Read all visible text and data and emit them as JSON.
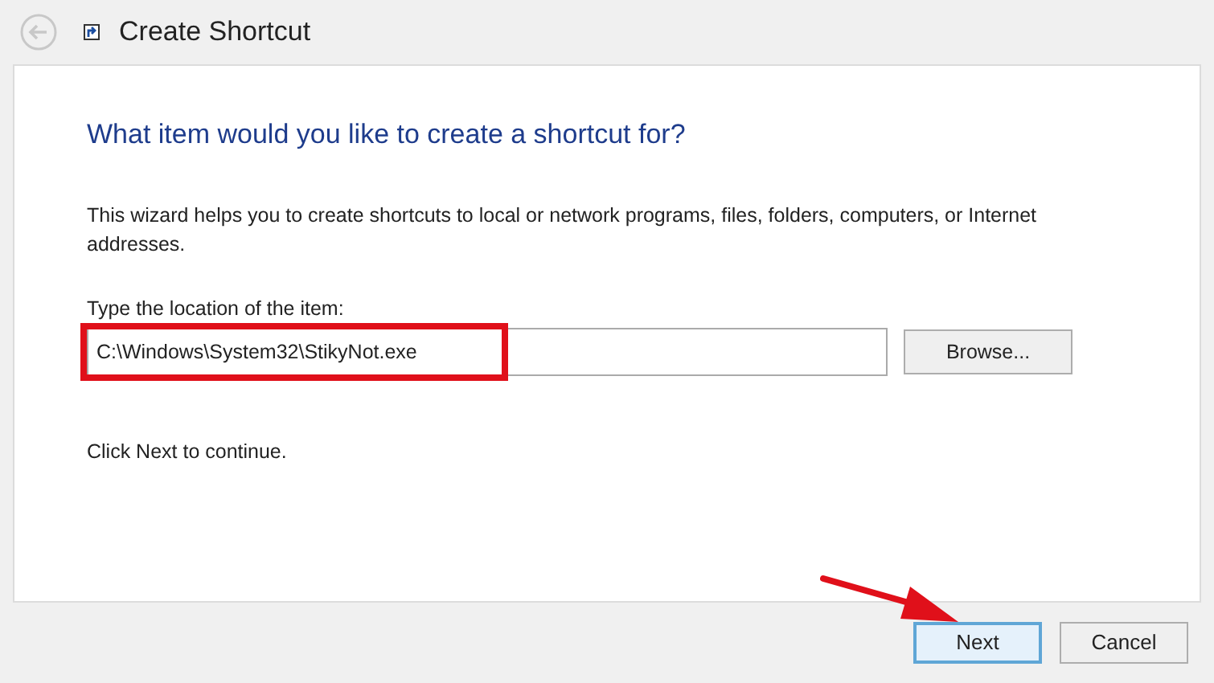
{
  "window": {
    "title": "Create Shortcut"
  },
  "heading": "What item would you like to create a shortcut for?",
  "description": "This wizard helps you to create shortcuts to local or network programs, files, folders, computers, or Internet addresses.",
  "location": {
    "label": "Type the location of the item:",
    "value": "C:\\Windows\\System32\\StikyNot.exe",
    "highlighted": true
  },
  "browse_button": "Browse...",
  "hint": "Click Next to continue.",
  "buttons": [
    {
      "label": "Next",
      "selected": true,
      "pointed": true
    },
    {
      "label": "Cancel",
      "selected": false,
      "pointed": false
    }
  ]
}
